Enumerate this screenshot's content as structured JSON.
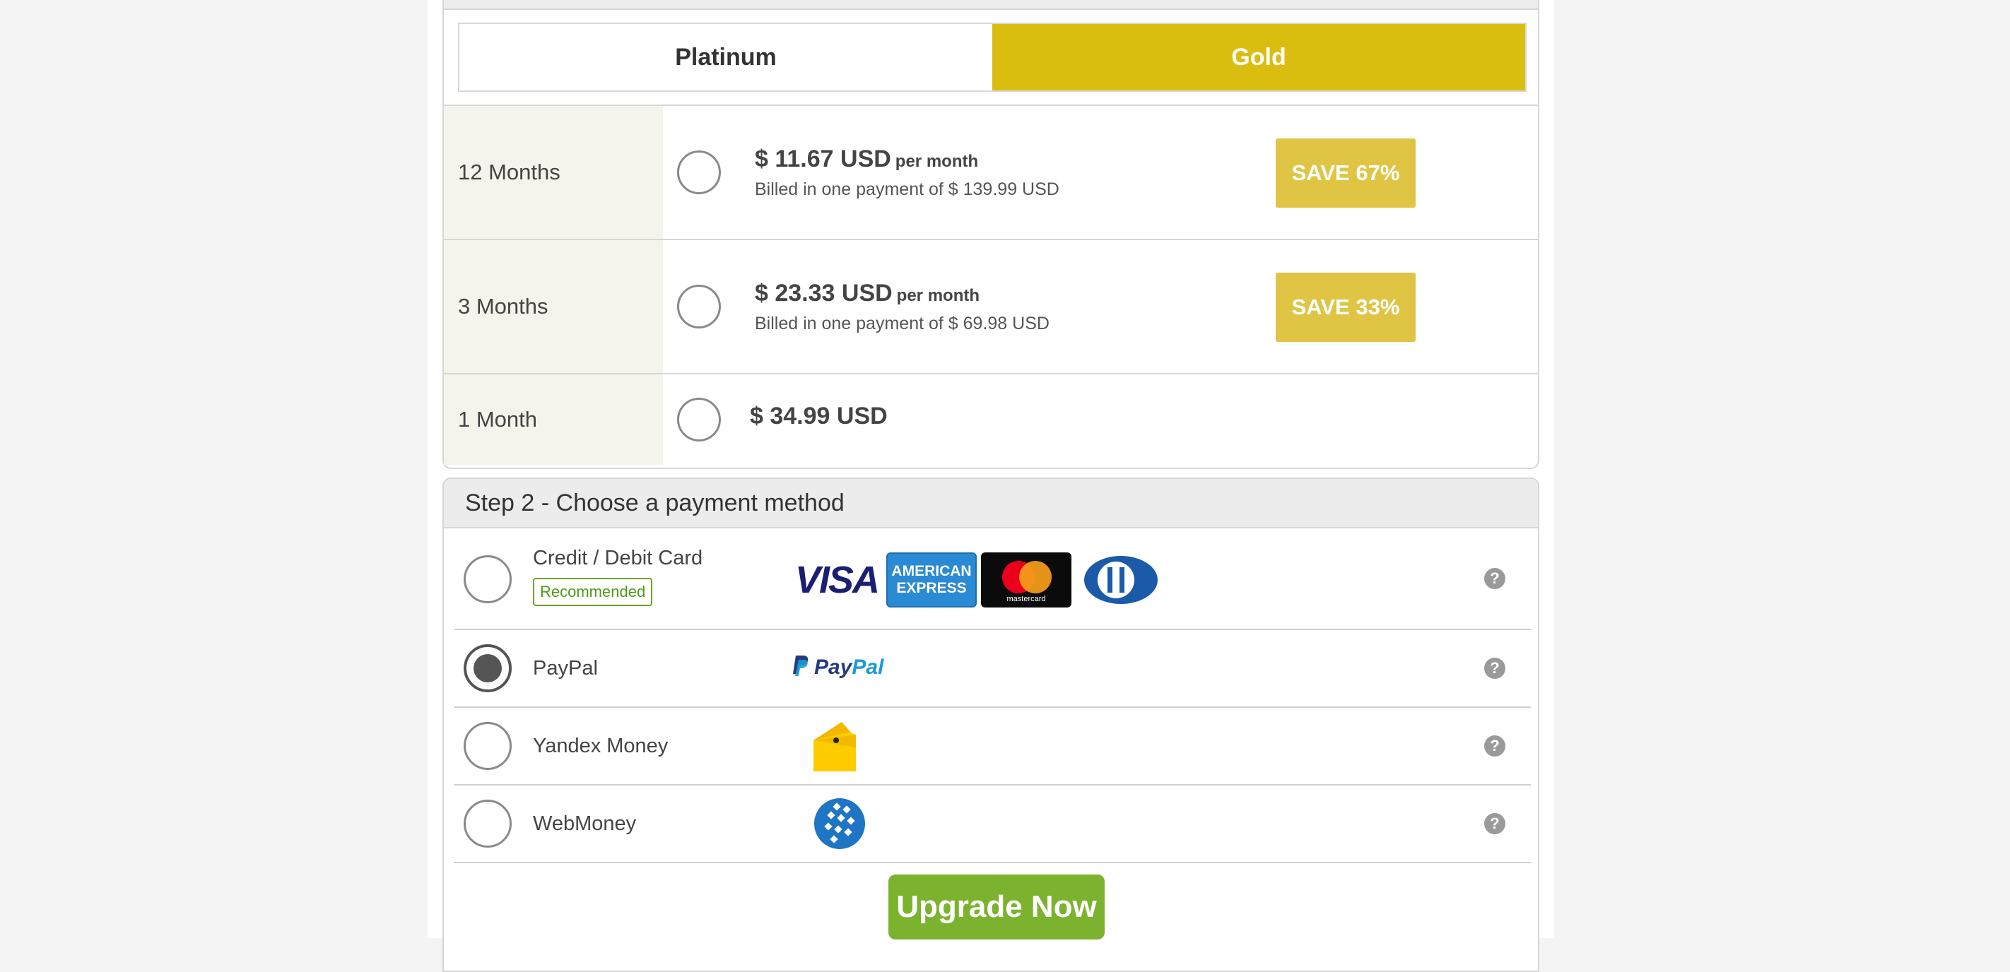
{
  "plan_tabs": [
    {
      "label": "Platinum",
      "active": false
    },
    {
      "label": "Gold",
      "active": true
    }
  ],
  "plans": [
    {
      "duration": "12 Months",
      "price": "$ 11.67 USD",
      "per": "per month",
      "billed": "Billed in one payment of $ 139.99 USD",
      "save": "SAVE 67%"
    },
    {
      "duration": "3 Months",
      "price": "$ 23.33 USD",
      "per": "per month",
      "billed": "Billed in one payment of $ 69.98 USD",
      "save": "SAVE 33%"
    },
    {
      "duration": "1 Month",
      "price": "$ 34.99 USD"
    }
  ],
  "payment": {
    "header": "Step 2 - Choose a payment method",
    "methods": [
      {
        "name": "Credit / Debit Card",
        "badge": "Recommended",
        "selected": false,
        "logos": [
          "visa",
          "american-express",
          "mastercard",
          "diners-club"
        ],
        "help": "?"
      },
      {
        "name": "PayPal",
        "selected": true,
        "logo_text_1": "Pay",
        "logo_text_2": "Pal",
        "help": "?"
      },
      {
        "name": "Yandex Money",
        "selected": false,
        "logo": "yandex-money-wallet",
        "help": "?"
      },
      {
        "name": "WebMoney",
        "selected": false,
        "logo": "webmoney-globe",
        "help": "?"
      }
    ]
  },
  "logos": {
    "visa": "VISA",
    "amex_line1": "AMERICAN",
    "amex_line2": "EXPRESS",
    "mastercard": "mastercard"
  },
  "upgrade_button": "Upgrade Now",
  "colors": {
    "gold": "#dabe0f",
    "save_badge": "#e0c545",
    "upgrade_green": "#7bb32e",
    "recommended_green": "#4e9a18"
  }
}
